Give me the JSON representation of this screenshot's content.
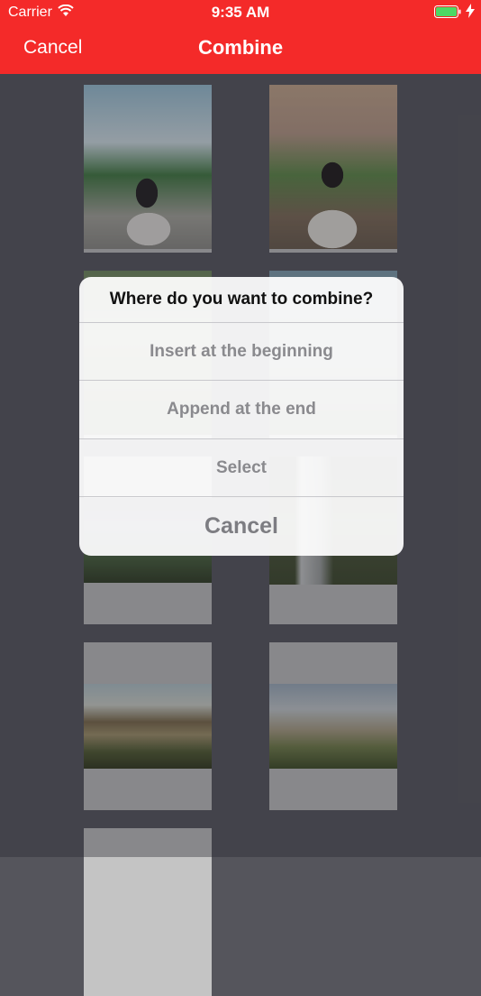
{
  "status_bar": {
    "carrier": "Carrier",
    "time": "9:35 AM",
    "wifi_icon": "wifi-icon",
    "battery_icon": "battery-icon",
    "charging_icon": "charging-bolt-icon"
  },
  "nav": {
    "cancel_label": "Cancel",
    "title": "Combine"
  },
  "colors": {
    "nav_background": "#f42a29",
    "page_background": "#55555c",
    "thumbnail_placeholder": "#c4c4c4"
  },
  "action_sheet": {
    "title": "Where do you want to combine?",
    "options": [
      "Insert at the beginning",
      "Append at the end",
      "Select"
    ],
    "cancel_label": "Cancel"
  }
}
